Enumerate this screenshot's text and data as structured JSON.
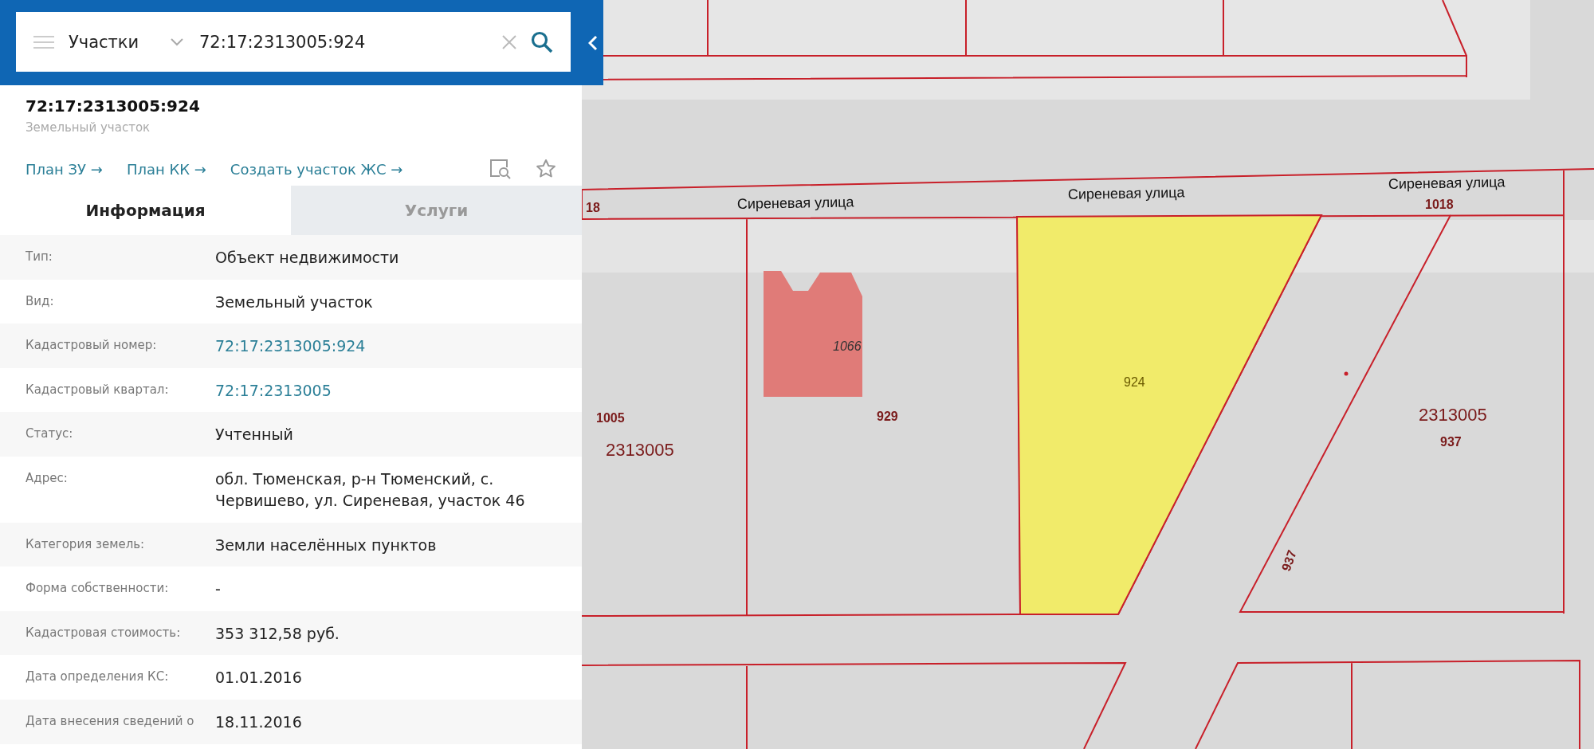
{
  "search": {
    "layer": "Участки",
    "query": "72:17:2313005:924"
  },
  "object": {
    "number": "72:17:2313005:924",
    "type": "Земельный участок"
  },
  "links": [
    "План ЗУ →",
    "План КК →",
    "Создать участок ЖС →"
  ],
  "tabs": [
    {
      "label": "Информация",
      "selected": true
    },
    {
      "label": "Услуги",
      "selected": false
    }
  ],
  "rows": [
    {
      "label": "Тип:",
      "value": "Объект недвижимости",
      "kind": "text"
    },
    {
      "label": "Вид:",
      "value": "Земельный участок",
      "kind": "text"
    },
    {
      "label": "Кадастровый номер:",
      "value": "72:17:2313005:924",
      "kind": "link"
    },
    {
      "label": "Кадастровый квартал:",
      "value": "72:17:2313005",
      "kind": "link"
    },
    {
      "label": "Статус:",
      "value": "Учтенный",
      "kind": "text"
    },
    {
      "label": "Адрес:",
      "value": "обл. Тюменская, р-н Тюменский, с. Червишево, ул. Сиреневая, участок 46",
      "kind": "text"
    },
    {
      "label": "Категория земель:",
      "value": "Земли населённых пунктов",
      "kind": "text"
    },
    {
      "label": "Форма собственности:",
      "value": "-",
      "kind": "text"
    },
    {
      "label": "Кадастровая стоимость:",
      "value": "353 312,58 руб.",
      "kind": "text"
    },
    {
      "label": "Дата определения КС:",
      "value": "01.01.2016",
      "kind": "text"
    },
    {
      "label": "Дата внесения сведений о",
      "value": "18.11.2016",
      "kind": "text"
    }
  ],
  "map": {
    "labels": [
      {
        "text": "18",
        "kind": "number"
      },
      {
        "text": "Сиреневая улица",
        "kind": "street"
      },
      {
        "text": "Сиреневая улица",
        "kind": "street"
      },
      {
        "text": "Сиреневая улица",
        "kind": "street"
      },
      {
        "text": "1018",
        "kind": "number"
      },
      {
        "text": "1066",
        "kind": "building"
      },
      {
        "text": "1005",
        "kind": "number"
      },
      {
        "text": "929",
        "kind": "number"
      },
      {
        "text": "924",
        "kind": "selected"
      },
      {
        "text": "2313005",
        "kind": "quarter"
      },
      {
        "text": "2313005",
        "kind": "quarter"
      },
      {
        "text": "937",
        "kind": "number"
      },
      {
        "text": "937",
        "kind": "number"
      }
    ]
  }
}
